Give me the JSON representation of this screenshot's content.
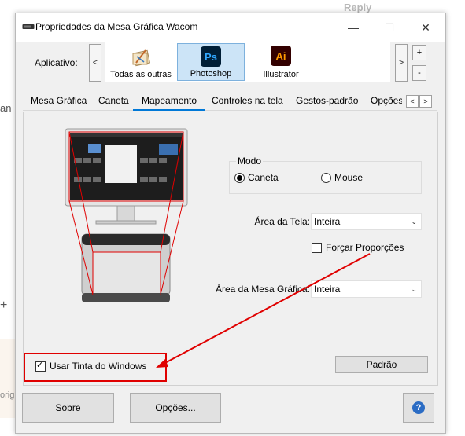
{
  "background": {
    "reply": "Reply",
    "frag_left": "an",
    "frag_plus": "+",
    "frag_bottom": "orig"
  },
  "window": {
    "title": "Propriedades da Mesa Gráfica Wacom",
    "minimize_icon": "—",
    "maximize_icon": "☐",
    "close_icon": "✕"
  },
  "apps": {
    "label": "Aplicativo:",
    "left_scroll": "<",
    "right_scroll": ">",
    "add": "+",
    "remove": "-",
    "items": [
      {
        "label": "Todas as outras",
        "icon": "all-apps-icon"
      },
      {
        "label": "Photoshop",
        "icon": "Ps",
        "selected": true,
        "color": "#31a8ff",
        "bg": "#001e36"
      },
      {
        "label": "Illustrator",
        "icon": "Ai",
        "color": "#ff9a00",
        "bg": "#330000"
      }
    ]
  },
  "tabs": {
    "items": [
      "Mesa Gráfica",
      "Caneta",
      "Mapeamento",
      "Controles na tela",
      "Gestos-padrão",
      "Opções"
    ],
    "active": "Mapeamento",
    "prev": "<",
    "next": ">"
  },
  "mapping": {
    "mode_legend": "Modo",
    "mode_pen": "Caneta",
    "mode_mouse": "Mouse",
    "mode_selected": "Caneta",
    "screen_area_label": "Área da Tela:",
    "screen_area_value": "Inteira",
    "force_proportions": "Forçar Proporções",
    "force_proportions_checked": false,
    "tablet_area_label": "Área da Mesa Gráfica:",
    "tablet_area_value": "Inteira",
    "windows_ink": "Usar Tinta do Windows",
    "windows_ink_checked": true,
    "default_button": "Padrão"
  },
  "footer": {
    "about": "Sobre",
    "options": "Opções...",
    "help_icon": "?"
  },
  "annotation_color": "#e00000"
}
